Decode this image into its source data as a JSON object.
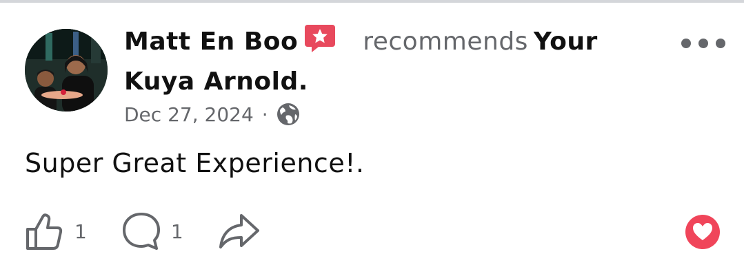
{
  "post": {
    "author": "Matt En Boo",
    "action": "recommends",
    "target": "Your Kuya Arnold",
    "period": ".",
    "date": "Dec 27, 2024",
    "separator": "·",
    "audience_icon": "globe-icon",
    "text": "Super Great Experience!.",
    "badge_icon": "recommendation-star-icon",
    "badge_color": "#e8495d"
  },
  "actions": {
    "like_icon": "thumbs-up-icon",
    "like_count": "1",
    "comment_icon": "comment-icon",
    "comment_count": "1",
    "share_icon": "share-icon",
    "reaction_icon": "heart-icon",
    "reaction_color": "#f0455a"
  },
  "more_icon": "more-options-icon"
}
